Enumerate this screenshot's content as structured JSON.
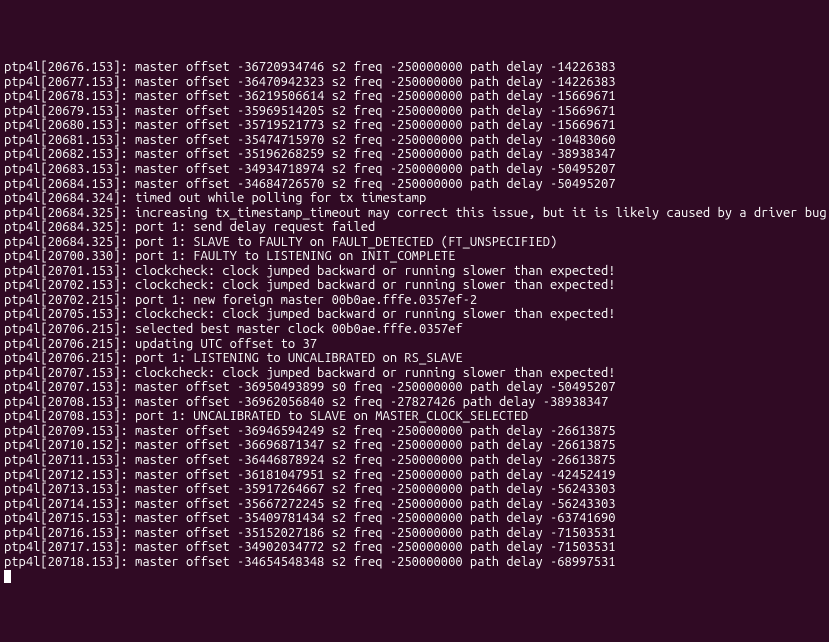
{
  "lines": [
    "ptp4l[20676.153]: master offset -36720934746 s2 freq -250000000 path delay -14226383",
    "ptp4l[20677.153]: master offset -36470942323 s2 freq -250000000 path delay -14226383",
    "ptp4l[20678.153]: master offset -36219506614 s2 freq -250000000 path delay -15669671",
    "ptp4l[20679.153]: master offset -35969514205 s2 freq -250000000 path delay -15669671",
    "ptp4l[20680.153]: master offset -35719521773 s2 freq -250000000 path delay -15669671",
    "ptp4l[20681.153]: master offset -35474715970 s2 freq -250000000 path delay -10483060",
    "ptp4l[20682.153]: master offset -35196268259 s2 freq -250000000 path delay -38938347",
    "ptp4l[20683.153]: master offset -34934718974 s2 freq -250000000 path delay -50495207",
    "ptp4l[20684.153]: master offset -34684726570 s2 freq -250000000 path delay -50495207",
    "ptp4l[20684.324]: timed out while polling for tx timestamp",
    "ptp4l[20684.325]: increasing tx_timestamp_timeout may correct this issue, but it is likely caused by a driver bug",
    "ptp4l[20684.325]: port 1: send delay request failed",
    "ptp4l[20684.325]: port 1: SLAVE to FAULTY on FAULT_DETECTED (FT_UNSPECIFIED)",
    "ptp4l[20700.330]: port 1: FAULTY to LISTENING on INIT_COMPLETE",
    "ptp4l[20701.153]: clockcheck: clock jumped backward or running slower than expected!",
    "ptp4l[20702.153]: clockcheck: clock jumped backward or running slower than expected!",
    "ptp4l[20702.215]: port 1: new foreign master 00b0ae.fffe.0357ef-2",
    "ptp4l[20705.153]: clockcheck: clock jumped backward or running slower than expected!",
    "ptp4l[20706.215]: selected best master clock 00b0ae.fffe.0357ef",
    "ptp4l[20706.215]: updating UTC offset to 37",
    "ptp4l[20706.215]: port 1: LISTENING to UNCALIBRATED on RS_SLAVE",
    "ptp4l[20707.153]: clockcheck: clock jumped backward or running slower than expected!",
    "ptp4l[20707.153]: master offset -36950493899 s0 freq -250000000 path delay -50495207",
    "ptp4l[20708.153]: master offset -36962056840 s2 freq -27827426 path delay -38938347",
    "ptp4l[20708.153]: port 1: UNCALIBRATED to SLAVE on MASTER_CLOCK_SELECTED",
    "ptp4l[20709.153]: master offset -36946594249 s2 freq -250000000 path delay -26613875",
    "ptp4l[20710.152]: master offset -36696871347 s2 freq -250000000 path delay -26613875",
    "ptp4l[20711.153]: master offset -36446878924 s2 freq -250000000 path delay -26613875",
    "ptp4l[20712.153]: master offset -36181047951 s2 freq -250000000 path delay -42452419",
    "ptp4l[20713.153]: master offset -35917264667 s2 freq -250000000 path delay -56243303",
    "ptp4l[20714.153]: master offset -35667272245 s2 freq -250000000 path delay -56243303",
    "ptp4l[20715.153]: master offset -35409781434 s2 freq -250000000 path delay -63741690",
    "ptp4l[20716.153]: master offset -35152027186 s2 freq -250000000 path delay -71503531",
    "ptp4l[20717.153]: master offset -34902034772 s2 freq -250000000 path delay -71503531",
    "ptp4l[20718.153]: master offset -34654548348 s2 freq -250000000 path delay -68997531"
  ]
}
